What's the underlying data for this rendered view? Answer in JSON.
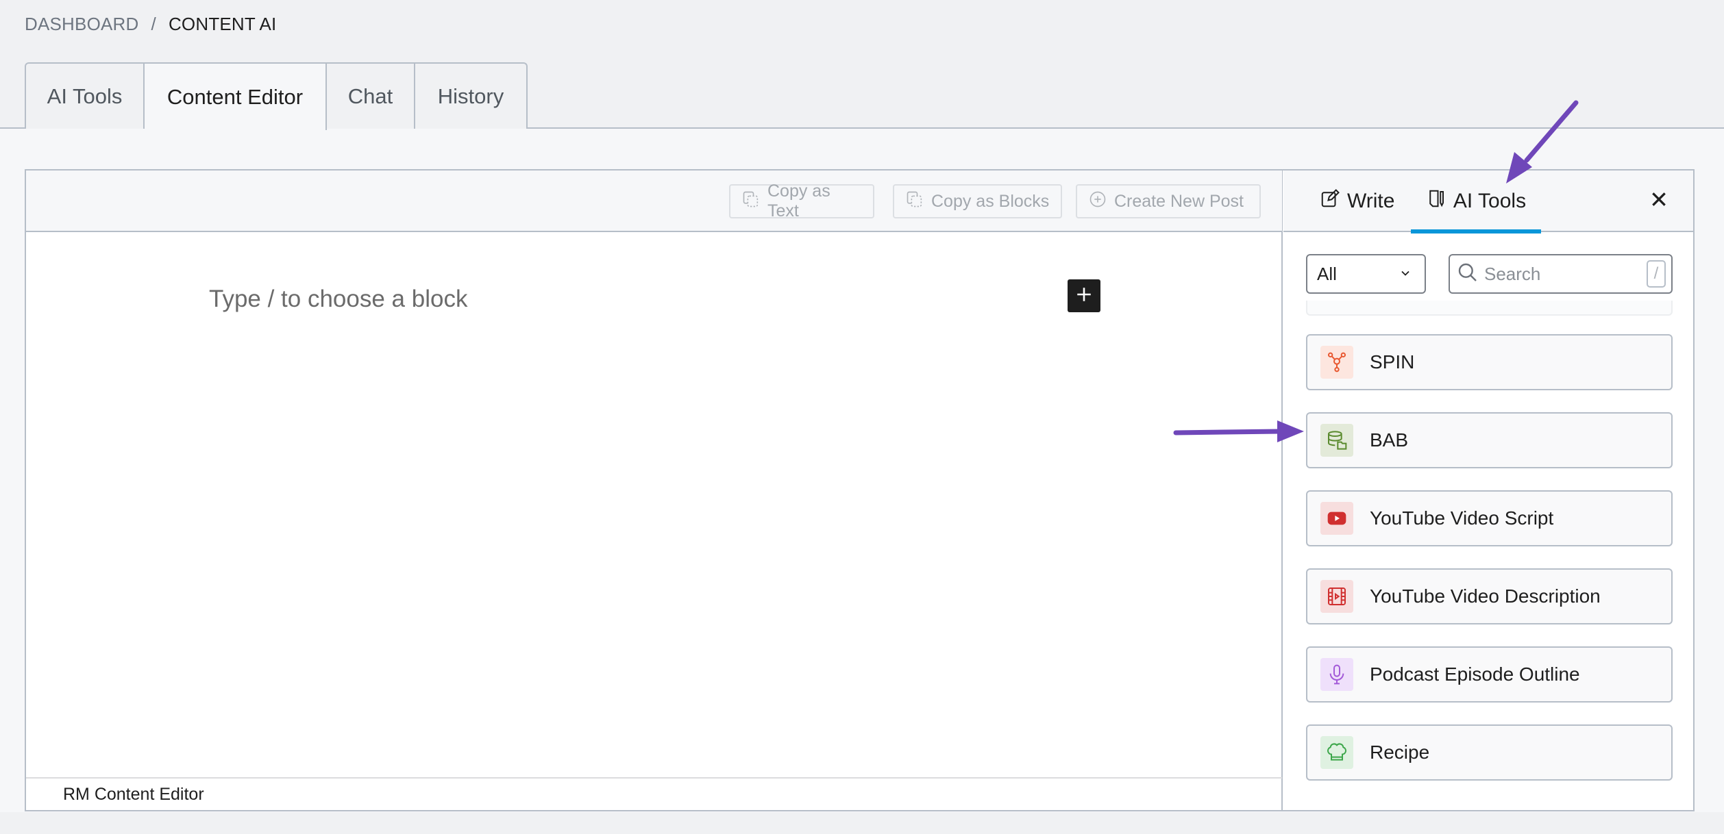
{
  "breadcrumb": {
    "parent": "DASHBOARD",
    "separator": "/",
    "current": "CONTENT AI"
  },
  "tabs": [
    {
      "label": "AI Tools",
      "active": false
    },
    {
      "label": "Content Editor",
      "active": true
    },
    {
      "label": "Chat",
      "active": false
    },
    {
      "label": "History",
      "active": false
    }
  ],
  "editor": {
    "toolbar": {
      "copy_text_label": "Copy as Text",
      "copy_blocks_label": "Copy as Blocks",
      "create_post_label": "Create New Post"
    },
    "placeholder": "Type / to choose a block",
    "add_block_icon": "plus-icon",
    "footer_label": "RM Content Editor"
  },
  "panel": {
    "tabs": [
      {
        "label": "Write",
        "icon": "edit-icon",
        "active": false
      },
      {
        "label": "AI Tools",
        "icon": "document-pen-icon",
        "active": true
      }
    ],
    "active_tab_color": "#0a96d9",
    "close_icon": "close-icon",
    "filter": {
      "selected": "All"
    },
    "search": {
      "placeholder": "Search",
      "value": "",
      "shortcut": "/"
    },
    "tools": [
      {
        "label": "SPIN",
        "icon": "network-icon",
        "color": "#e8572f",
        "bg": "#fde6df"
      },
      {
        "label": "BAB",
        "icon": "database-folder-icon",
        "color": "#5a8a2e",
        "bg": "#e3ead9"
      },
      {
        "label": "YouTube Video Script",
        "icon": "youtube-icon",
        "color": "#d02f2f",
        "bg": "#f7dede"
      },
      {
        "label": "YouTube Video Description",
        "icon": "film-icon",
        "color": "#d02f2f",
        "bg": "#f7dede"
      },
      {
        "label": "Podcast Episode Outline",
        "icon": "microphone-icon",
        "color": "#a35ad8",
        "bg": "#efe0fb"
      },
      {
        "label": "Recipe",
        "icon": "chef-hat-icon",
        "color": "#3ca64a",
        "bg": "#dff1e1"
      }
    ]
  },
  "annotations": {
    "arrow_color": "#6f47b9"
  }
}
